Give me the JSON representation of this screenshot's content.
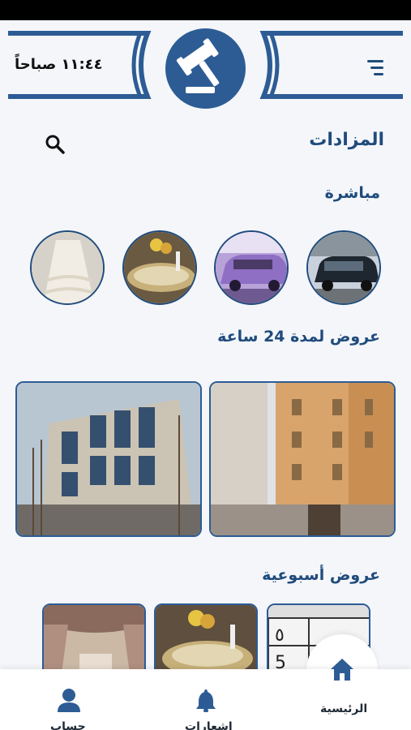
{
  "status_bar": {},
  "header": {
    "time": "١١:٤٤ صباحاً",
    "logo_text": "مزاد",
    "menu_icon": "hamburger-icon"
  },
  "auctions": {
    "title": "المزادات",
    "search_icon": "search-icon"
  },
  "live": {
    "title": "مباشرة",
    "items": [
      {
        "name": "black-suv"
      },
      {
        "name": "purple-suv"
      },
      {
        "name": "decor-table"
      },
      {
        "name": "white-dress"
      }
    ]
  },
  "offers_24h": {
    "title": "عروض لمدة 24 ساعة",
    "items": [
      {
        "name": "apartment-building"
      },
      {
        "name": "glass-building"
      }
    ]
  },
  "weekly": {
    "title": "عروض أسبوعية",
    "items": [
      {
        "name": "license-plate"
      },
      {
        "name": "decor-table"
      },
      {
        "name": "curtains"
      }
    ]
  },
  "bottom_nav": {
    "home": "الرئيسية",
    "notifications": "اشعارات",
    "account": "حساب"
  },
  "colors": {
    "primary": "#2d5c95",
    "text": "#1f4b7c",
    "background": "#f4f6fa"
  }
}
